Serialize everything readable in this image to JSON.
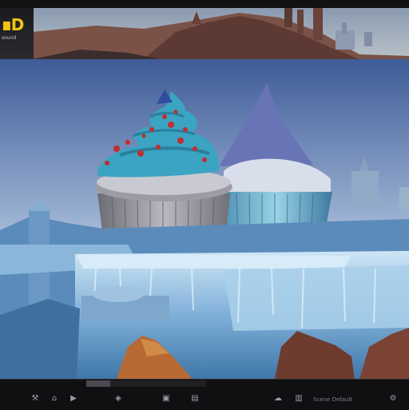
{
  "app": {
    "logo_text": "D",
    "logo_subtitle": "sound"
  },
  "banner": {
    "description_icon": "desert-castle-scene"
  },
  "viewport": {
    "scene": "cupcake-on-ice-castle"
  },
  "status_bar": {
    "progress": 0.2,
    "label_right": "Scene  Default",
    "icons": [
      "tools-icon",
      "camera-icon",
      "play-icon",
      "cursor-icon",
      "cloud-icon",
      "layers-icon",
      "folder-icon",
      "lock-icon",
      "settings-icon"
    ],
    "colors": {
      "bar": "#101012",
      "text": "#7e7e86",
      "accent": "#f1c50f"
    }
  }
}
